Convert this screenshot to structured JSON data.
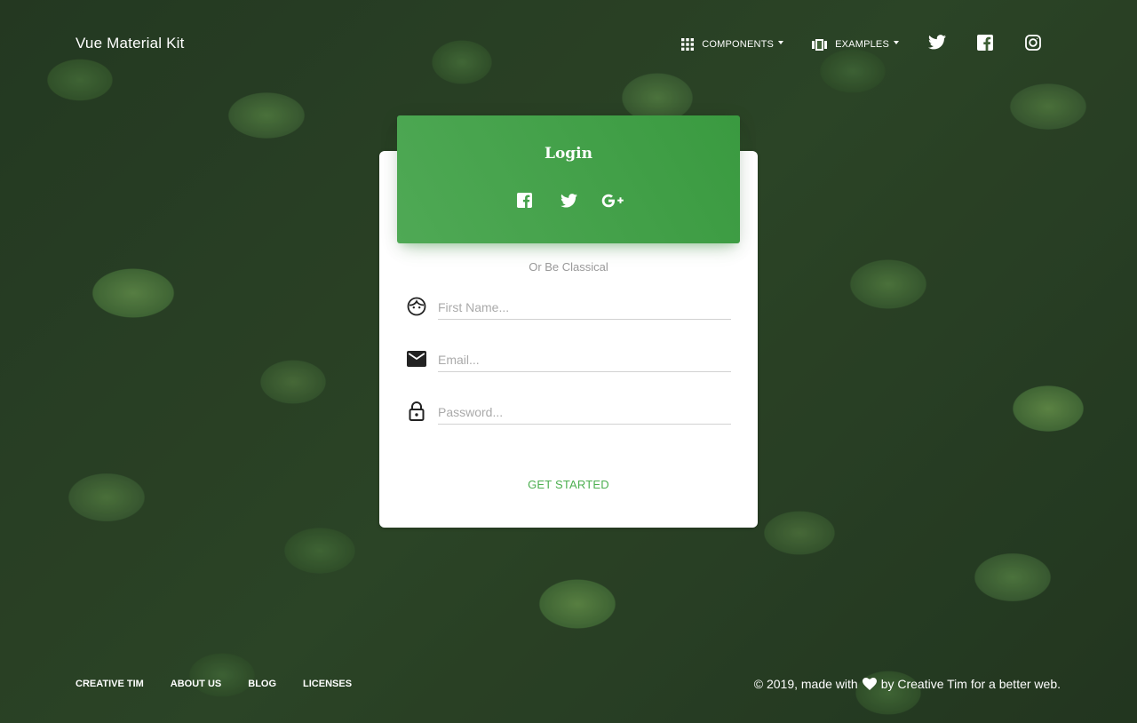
{
  "navbar": {
    "brand": "Vue Material Kit",
    "items": [
      {
        "label": "Components",
        "icon": "apps-icon"
      },
      {
        "label": "Examples",
        "icon": "view-carousel-icon"
      }
    ],
    "socials": [
      "twitter-icon",
      "facebook-icon",
      "instagram-icon"
    ]
  },
  "card": {
    "title": "Login",
    "header_socials": [
      "facebook-icon",
      "twitter-icon",
      "google-plus-icon"
    ],
    "divider_text": "Or Be Classical",
    "fields": {
      "first_name": {
        "placeholder": "First Name...",
        "value": "",
        "icon": "face-icon"
      },
      "email": {
        "placeholder": "Email...",
        "value": "",
        "icon": "email-icon"
      },
      "password": {
        "placeholder": "Password...",
        "value": "",
        "icon": "lock-icon"
      }
    },
    "submit_label": "Get Started"
  },
  "footer": {
    "links": [
      "Creative Tim",
      "About Us",
      "Blog",
      "Licenses"
    ],
    "copyright_prefix": "© 2019, made with",
    "copyright_suffix": "by Creative Tim for a better web."
  },
  "colors": {
    "accent": "#4caf50",
    "header_gradient_start": "#4fa955",
    "header_gradient_end": "#3a9a40"
  }
}
